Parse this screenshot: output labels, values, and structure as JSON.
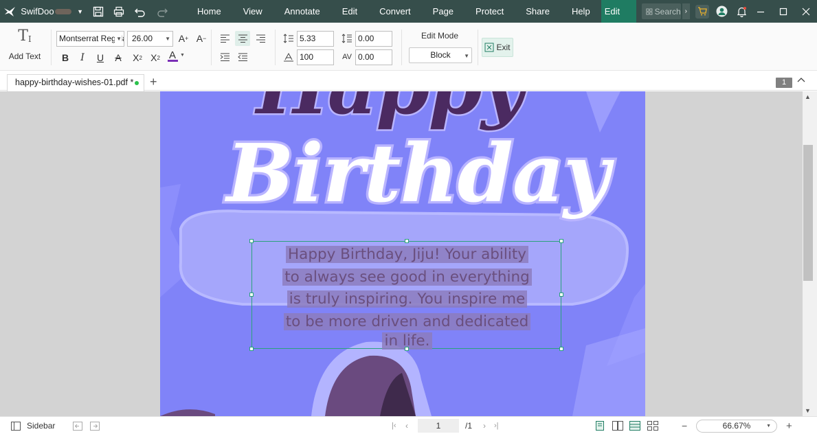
{
  "app": {
    "name": "SwifDoo",
    "menu": [
      "Home",
      "View",
      "Annotate",
      "Edit",
      "Convert",
      "Page",
      "Protect",
      "Share",
      "Help",
      "Edit Format"
    ],
    "active_menu": "Edit Format",
    "search_placeholder": "Search"
  },
  "ribbon": {
    "add_text_label": "Add Text",
    "font_family": "Montserrat Regular",
    "font_size": "26.00",
    "line_spacing": "5.33",
    "paragraph_spacing": "0.00",
    "scale": "100",
    "char_spacing": "0.00",
    "edit_mode_label": "Edit Mode",
    "edit_mode_value": "Block",
    "exit_label": "Exit",
    "text_color": "#7a2fb6"
  },
  "tabs": {
    "doc_title": "happy-birthday-wishes-01.pdf *",
    "page_badge": "1"
  },
  "document": {
    "heading_1": "Happy",
    "heading_2": "Birthday",
    "selected_text_lines": [
      "Happy Birthday, Jiju! Your ability",
      "to always see good in everything",
      "is truly inspiring. You inspire me",
      "to be more driven and dedicated",
      "in life."
    ]
  },
  "status": {
    "sidebar_label": "Sidebar",
    "current_page": "1",
    "total_pages": "/1",
    "zoom": "66.67%"
  },
  "colors": {
    "menubar": "#364e4b",
    "active_menu": "#1f7c62",
    "page_bg": "#8083f8",
    "selection_border": "#2aa27c"
  }
}
